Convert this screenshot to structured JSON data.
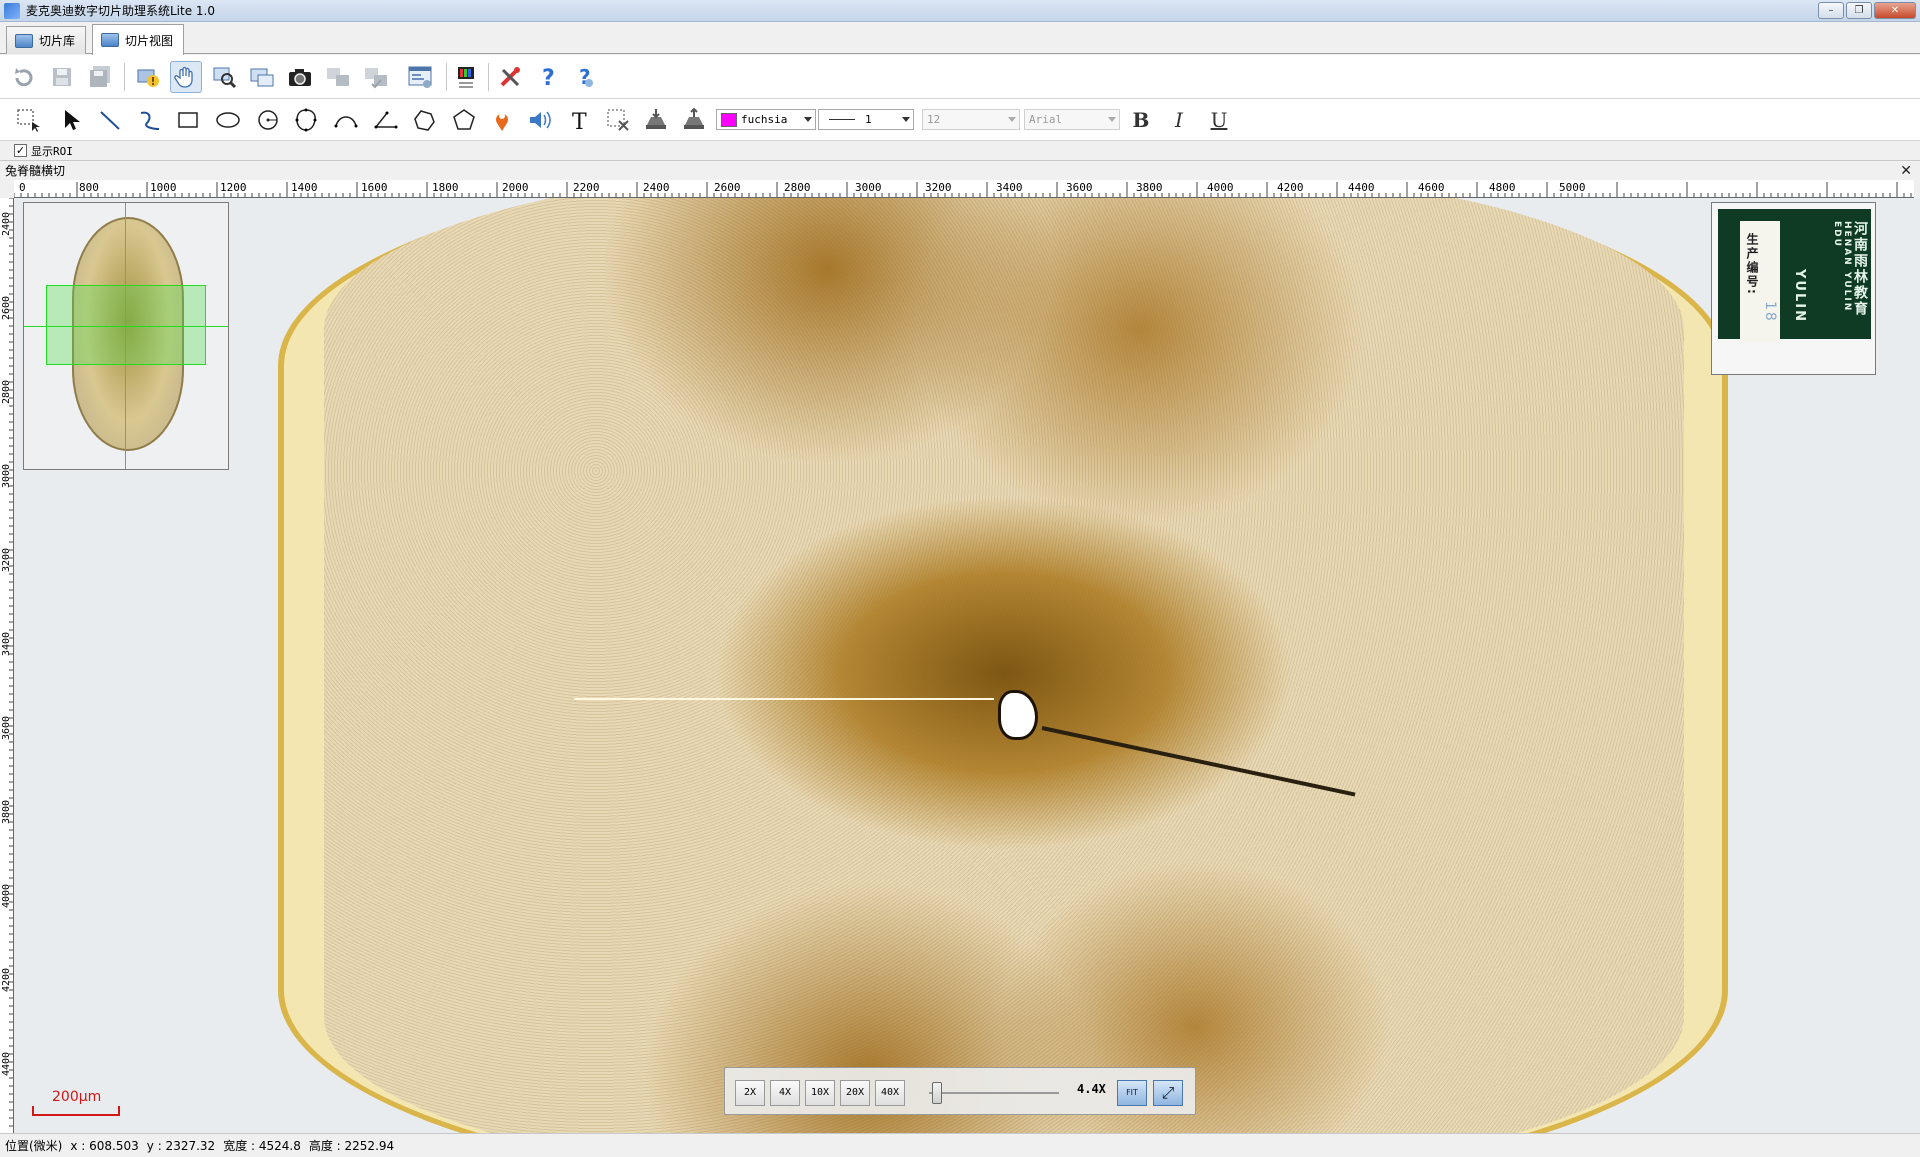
{
  "window": {
    "title": "麦克奥迪数字切片助理系统Lite 1.0",
    "minimize_symbol": "–",
    "maximize_symbol": "❐",
    "close_symbol": "✕"
  },
  "tabs": [
    {
      "label": "切片库",
      "icon": "slide-library-icon"
    },
    {
      "label": "切片视图",
      "icon": "slide-view-icon"
    }
  ],
  "toolbar_main": [
    "rotate-icon",
    "save-icon",
    "save-all-icon",
    "slide-info-icon",
    "pan-hand-icon",
    "zoom-search-icon",
    "navigator-icon",
    "camera-icon",
    "compare-icon",
    "sync-icon",
    "report-icon",
    "color-adjust-icon",
    "settings-tools-icon",
    "help-icon",
    "help-context-icon"
  ],
  "annotation_tools": [
    "rect-select-icon",
    "pointer-icon",
    "line-icon",
    "curve-icon",
    "rectangle-icon",
    "ellipse-icon",
    "circle-icon",
    "closed-curve-icon",
    "arc-icon",
    "angle-icon",
    "freehand-polygon-icon",
    "polygon-icon",
    "marker-pin-icon",
    "audio-note-icon",
    "text-icon",
    "delete-annotation-icon",
    "import-annotation-icon",
    "export-annotation-icon"
  ],
  "format": {
    "color_name": "fuchsia",
    "color_hex": "#ff00ff",
    "line_width": "1",
    "font_size": "12",
    "font_name": "Arial",
    "bold": "B",
    "italic": "I",
    "underline": "U"
  },
  "roi": {
    "checked": true,
    "check_mark": "✓",
    "label": "显示ROI"
  },
  "document": {
    "title": "兔脊髓横切",
    "close_symbol": "✕"
  },
  "ruler": {
    "horizontal": [
      "0",
      "800",
      "1000",
      "1200",
      "1400",
      "1600",
      "1800",
      "2000",
      "2200",
      "2400",
      "2600",
      "2800",
      "3000",
      "3200",
      "3400",
      "3600",
      "3800",
      "4000",
      "4200",
      "4400",
      "4600",
      "4800",
      "5000"
    ],
    "vertical": [
      "2400",
      "2600",
      "2800",
      "3000",
      "3200",
      "3400",
      "3600",
      "3800",
      "4000",
      "4200",
      "4400"
    ]
  },
  "slide_label": {
    "line1": "河南雨林教育",
    "line2": "HENAN YULIN EDU",
    "line3": "生产编号:",
    "brand": "YULIN",
    "code": "18"
  },
  "scale_bar": {
    "text": "200μm"
  },
  "zoom": {
    "buttons": [
      "2X",
      "4X",
      "10X",
      "20X",
      "40X"
    ],
    "current": "4.4X",
    "slider_fraction": 0.06,
    "fit_label": "FIT",
    "fullscreen_label": "⤢"
  },
  "status": {
    "position_label": "位置(微米)",
    "x": "x : 608.503",
    "y": "y : 2327.32",
    "width": "宽度 : 4524.8",
    "height": "高度 : 2252.94"
  }
}
